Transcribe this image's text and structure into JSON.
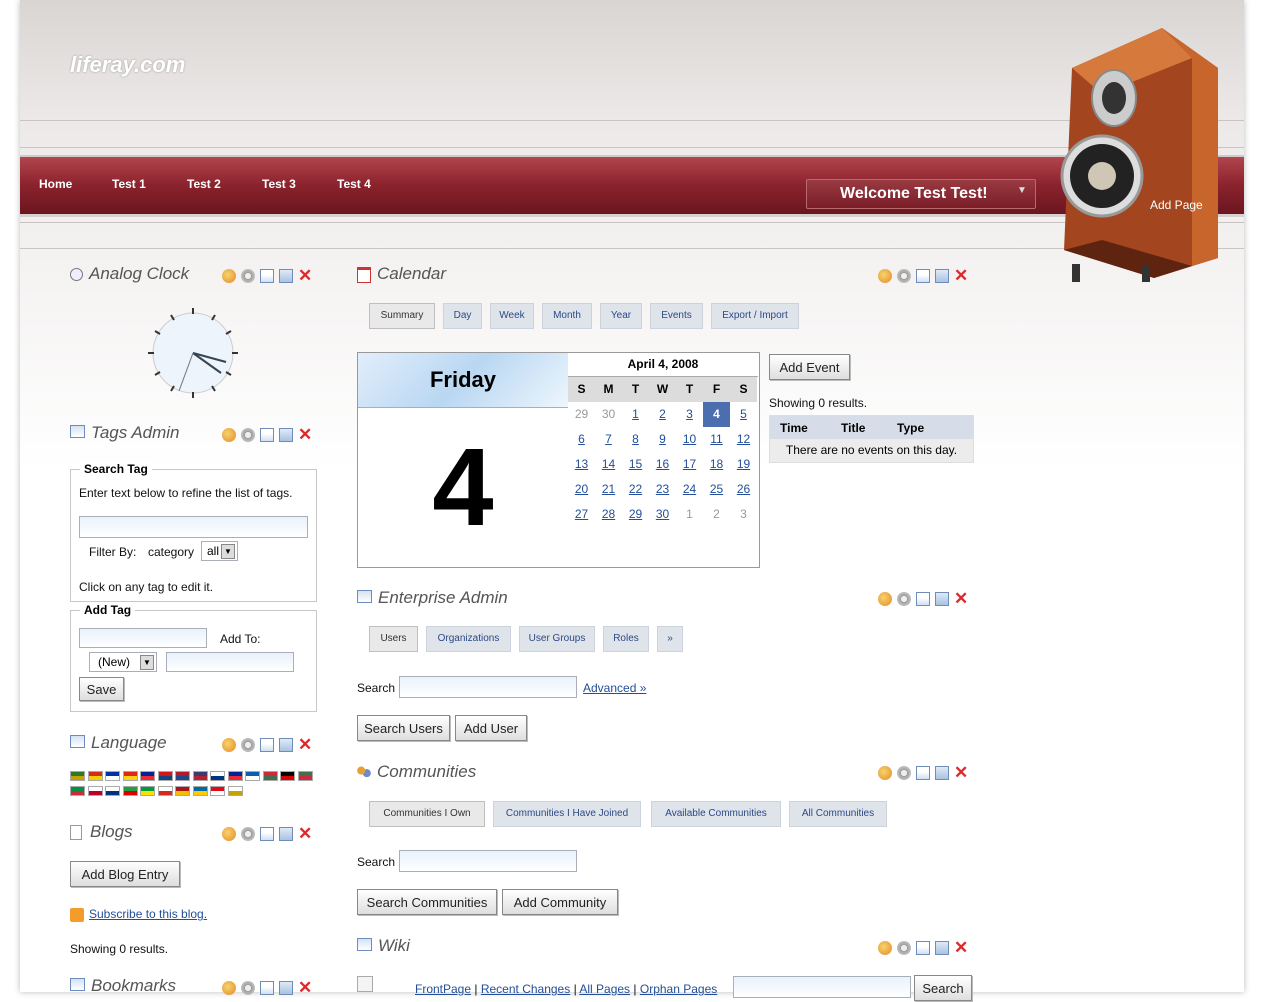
{
  "header": {
    "logo": "liferay.com",
    "nav": [
      "Home",
      "Test 1",
      "Test 2",
      "Test 3",
      "Test 4"
    ],
    "welcome": "Welcome Test Test!",
    "add_page": "Add Page"
  },
  "analog_clock": {
    "title": "Analog Clock"
  },
  "tags_admin": {
    "title": "Tags Admin",
    "search_legend": "Search Tag",
    "search_hint": "Enter text below to refine the list of tags.",
    "filter_by": "Filter By:",
    "filter_label": "category",
    "filter_value": "all",
    "click_hint": "Click on any tag to edit it.",
    "add_legend": "Add Tag",
    "add_to": "Add To:",
    "new_value": "(New)",
    "save": "Save"
  },
  "language": {
    "title": "Language"
  },
  "blogs": {
    "title": "Blogs",
    "add_entry": "Add Blog Entry",
    "subscribe": "Subscribe to this blog.",
    "results": "Showing 0 results."
  },
  "bookmarks": {
    "title": "Bookmarks"
  },
  "calendar": {
    "title": "Calendar",
    "tabs": [
      "Summary",
      "Day",
      "Week",
      "Month",
      "Year",
      "Events",
      "Export / Import"
    ],
    "day_name": "Friday",
    "day_number": "4",
    "month_title": "April 4, 2008",
    "weekdays": [
      "S",
      "M",
      "T",
      "W",
      "T",
      "F",
      "S"
    ],
    "weeks": [
      [
        "29",
        "30",
        "1",
        "2",
        "3",
        "4",
        "5"
      ],
      [
        "6",
        "7",
        "8",
        "9",
        "10",
        "11",
        "12"
      ],
      [
        "13",
        "14",
        "15",
        "16",
        "17",
        "18",
        "19"
      ],
      [
        "20",
        "21",
        "22",
        "23",
        "24",
        "25",
        "26"
      ],
      [
        "27",
        "28",
        "29",
        "30",
        "1",
        "2",
        "3"
      ]
    ],
    "add_event": "Add Event",
    "results": "Showing 0 results.",
    "columns": [
      "Time",
      "Title",
      "Type"
    ],
    "empty": "There are no events on this day."
  },
  "enterprise_admin": {
    "title": "Enterprise Admin",
    "tabs": [
      "Users",
      "Organizations",
      "User Groups",
      "Roles",
      "»"
    ],
    "search_label": "Search",
    "advanced": "Advanced »",
    "search_btn": "Search Users",
    "add_btn": "Add User"
  },
  "communities": {
    "title": "Communities",
    "tabs": [
      "Communities I Own",
      "Communities I Have Joined",
      "Available Communities",
      "All Communities"
    ],
    "search_label": "Search",
    "search_btn": "Search Communities",
    "add_btn": "Add Community"
  },
  "wiki": {
    "title": "Wiki",
    "links": [
      "FrontPage",
      "Recent Changes",
      "All Pages",
      "Orphan Pages"
    ],
    "search_btn": "Search"
  }
}
